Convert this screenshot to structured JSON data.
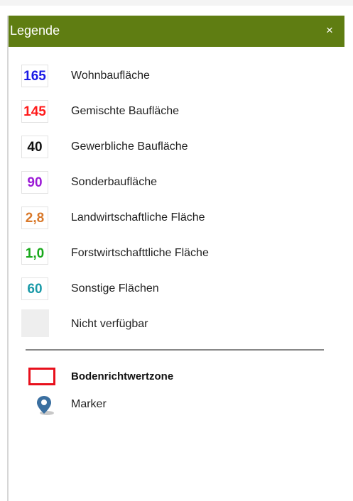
{
  "legend": {
    "title": "Legende",
    "close_label": "×",
    "items": [
      {
        "value": "165",
        "label": "Wohnbaufläche",
        "color": "#1a1ae6"
      },
      {
        "value": "145",
        "label": "Gemischte Baufläche",
        "color": "#ff1a1a"
      },
      {
        "value": "40",
        "label": "Gewerbliche Baufläche",
        "color": "#111111"
      },
      {
        "value": "90",
        "label": "Sonderbaufläche",
        "color": "#9b1ad6"
      },
      {
        "value": "2,8",
        "label": "Landwirtschaftliche Fläche",
        "color": "#d9792a"
      },
      {
        "value": "1,0",
        "label": "Forstwirtschafttliche Fläche",
        "color": "#17a81a"
      },
      {
        "value": "60",
        "label": "Sonstige Flächen",
        "color": "#1a9aa8"
      },
      {
        "value": "",
        "label": "Nicht verfügbar",
        "color": "#eeeeee"
      }
    ],
    "zone": {
      "label": "Bodenrichtwertzone",
      "color": "#e8101c"
    },
    "marker": {
      "label": "Marker",
      "icon": "map-marker-icon",
      "color": "#3a6fa0"
    }
  },
  "colors": {
    "header_bg": "#5f7d12",
    "header_text": "#ffffff"
  }
}
